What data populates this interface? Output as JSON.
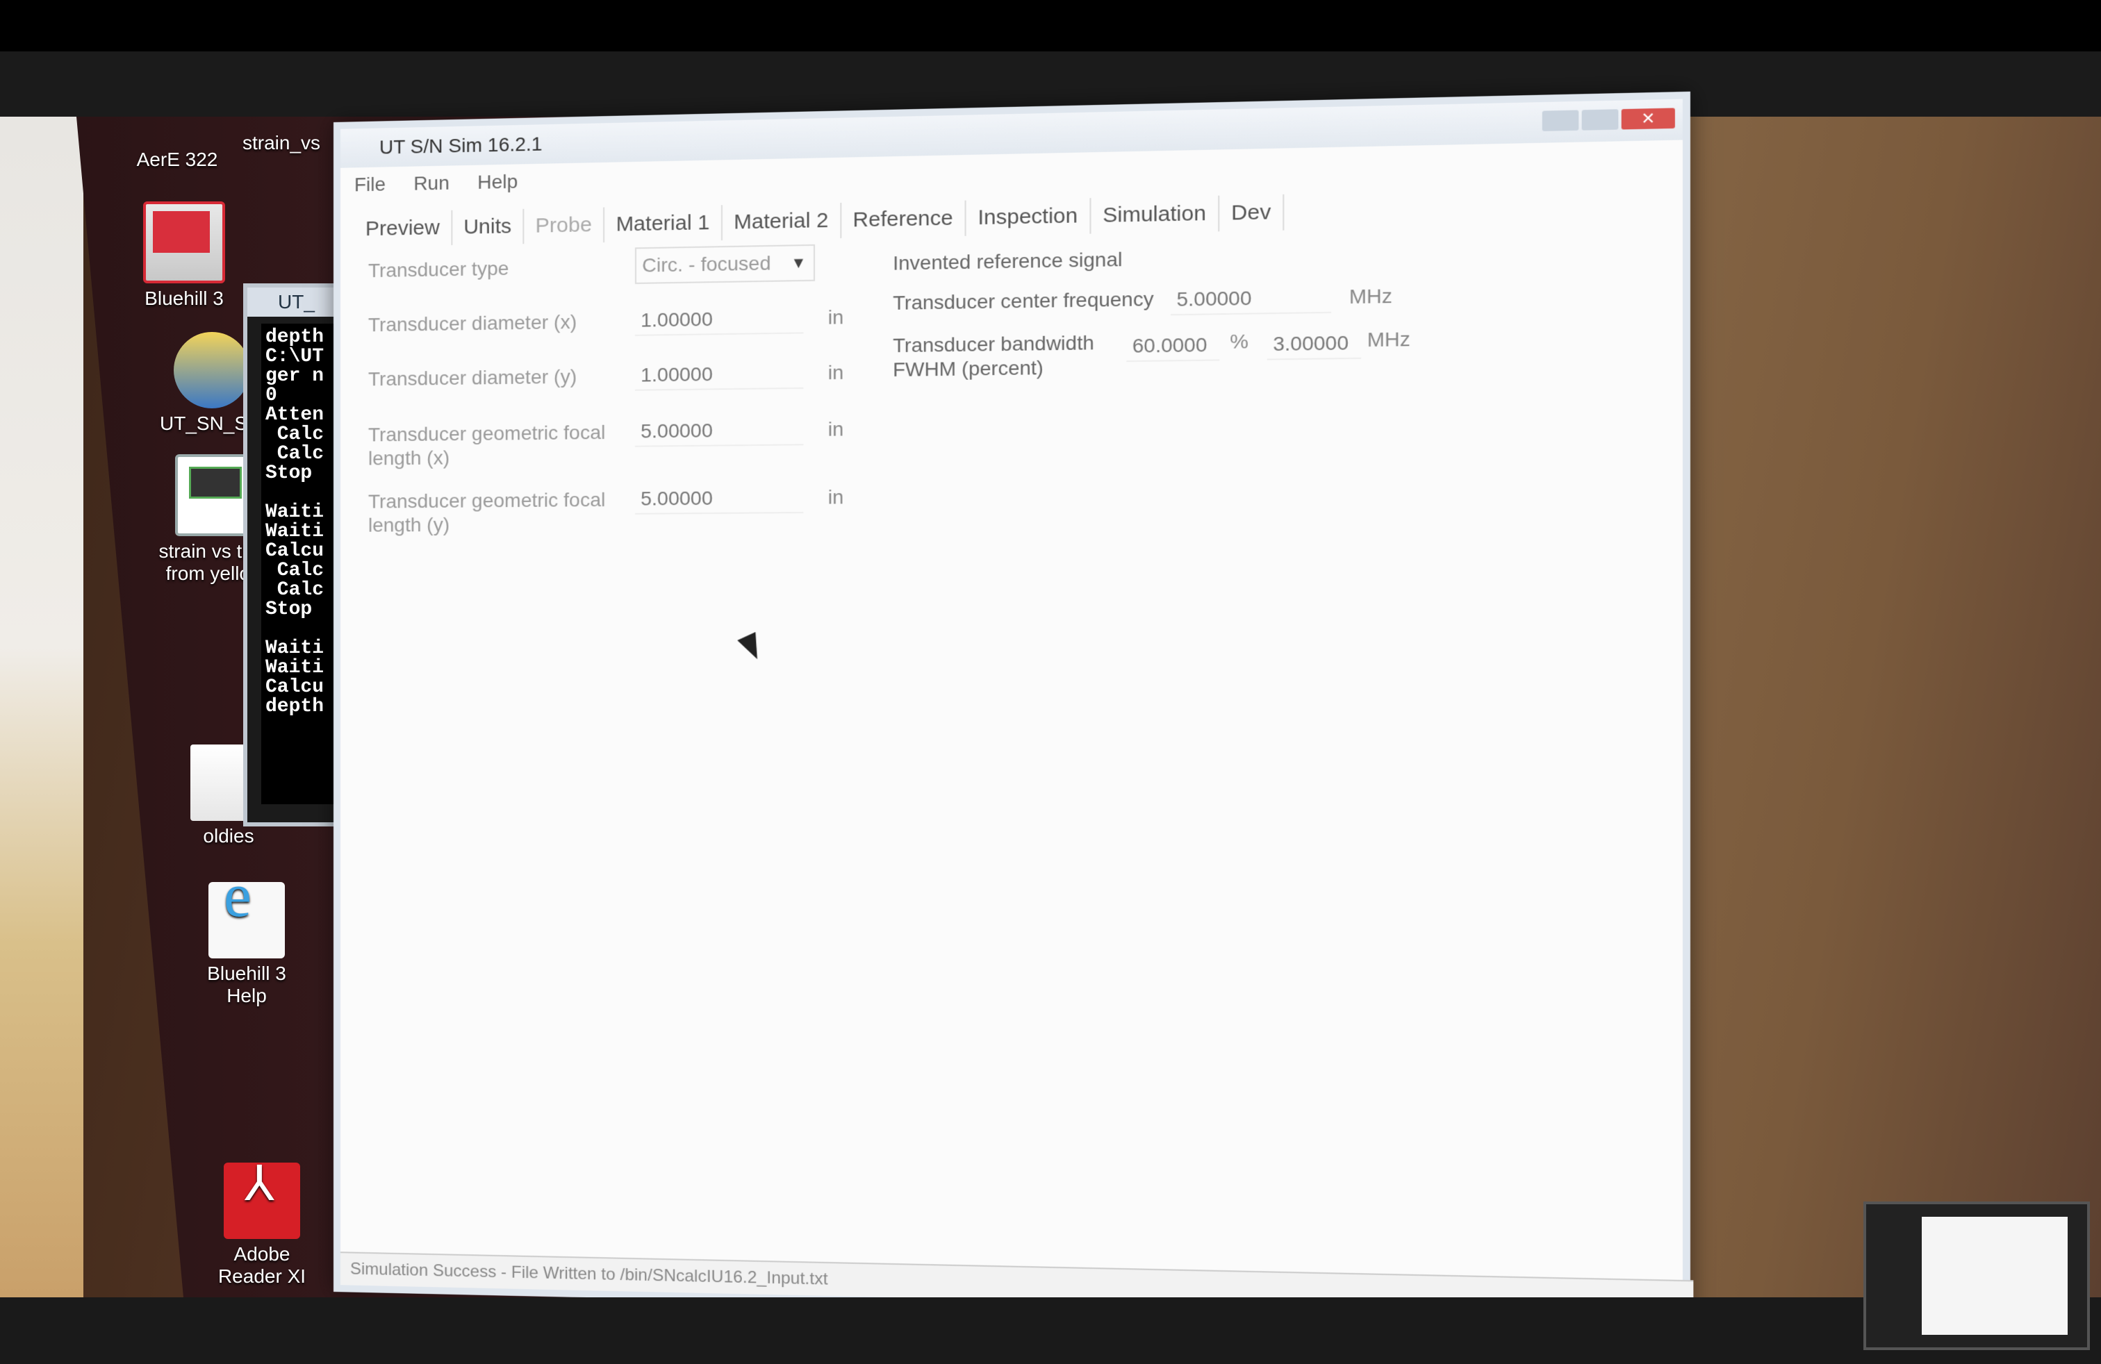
{
  "desktop": {
    "icons": [
      {
        "label": "AerE 322",
        "icon": "folder-icon"
      },
      {
        "label": "strain_vs",
        "icon": "folder-icon"
      },
      {
        "label": "Bluehill 3",
        "icon": "bluehill-app-icon"
      },
      {
        "label": "UT_SN_Sim",
        "icon": "python-script-icon"
      },
      {
        "label": "strain vs time from yello...",
        "icon": "oscilloscope-app-icon"
      },
      {
        "label": "oldies",
        "icon": "folder-icon"
      },
      {
        "label": "Bluehill 3 Help",
        "icon": "help-browser-icon"
      },
      {
        "label": "Adobe Reader XI",
        "icon": "pdf-reader-icon"
      }
    ]
  },
  "console": {
    "title": "UT_",
    "lines": [
      "depth",
      "C:\\UT",
      "ger n",
      "0",
      "Atten",
      " Calc",
      " Calc",
      "Stop",
      "",
      "Waiti",
      "Waiti",
      "Calcu",
      " Calc",
      " Calc",
      "Stop",
      "",
      "Waiti",
      "Waiti",
      "Calcu",
      "depth"
    ]
  },
  "app": {
    "title": "UT S/N Sim 16.2.1",
    "menu": [
      "File",
      "Run",
      "Help"
    ],
    "tabs": [
      "Preview",
      "Units",
      "Probe",
      "Material 1",
      "Material 2",
      "Reference",
      "Inspection",
      "Simulation",
      "Dev"
    ],
    "probe": {
      "transducer_type_label": "Transducer type",
      "transducer_type_value": "Circ. - focused",
      "diameter_x_label": "Transducer diameter (x)",
      "diameter_x_value": "1.00000",
      "diameter_y_label": "Transducer diameter (y)",
      "diameter_y_value": "1.00000",
      "focal_x_label": "Transducer geometric focal length (x)",
      "focal_x_value": "5.00000",
      "focal_y_label": "Transducer geometric focal length (y)",
      "focal_y_value": "5.00000",
      "length_unit": "in"
    },
    "reference": {
      "title": "Invented reference signal",
      "center_freq_label": "Transducer center frequency",
      "center_freq_value": "5.00000",
      "center_freq_unit": "MHz",
      "bandwidth_label": "Transducer bandwidth FWHM (percent)",
      "bandwidth_percent_value": "60.0000",
      "percent_symbol": "%",
      "bandwidth_mhz_value": "3.00000",
      "bandwidth_mhz_unit": "MHz"
    },
    "status": "Simulation Success - File Written to /bin/SNcalcIU16.2_Input.txt"
  }
}
